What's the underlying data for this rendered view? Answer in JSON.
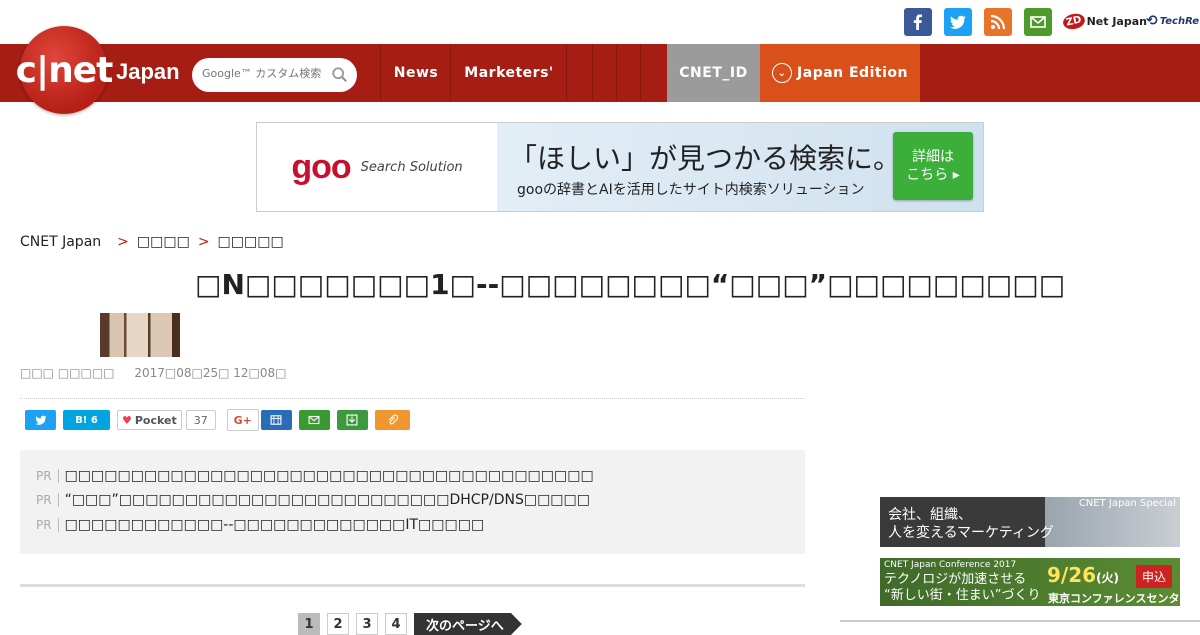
{
  "social": {
    "colors": {
      "facebook": "#3b5998",
      "twitter": "#1da1f2",
      "rss": "#e8742a",
      "mail": "#4e9a2b"
    },
    "zdnet": "Net Japan",
    "zdnet_badge": "ZD",
    "techrepublic": "TechRe"
  },
  "header": {
    "logo": "c|net",
    "logo_sub": "Japan",
    "search_placeholder": "Google™ カスタム検索",
    "nav": [
      "News",
      "Marketers'"
    ],
    "cnet_id": "CNET_ID",
    "edition": "Japan Edition",
    "colors": {
      "bar": "#a61d14",
      "cnet_id_bg": "#9b9b9b",
      "edition_bg": "#d9501a"
    }
  },
  "ad": {
    "brand": "goo",
    "brand_sub": "Search Solution",
    "headline": "「ほしい」が見つかる検索に。",
    "sub": "gooの辞書とAIを活用したサイト内検索ソリューション",
    "button_line1": "詳細は",
    "button_line2": "こちら ▸"
  },
  "breadcrumb": {
    "home": "CNET Japan",
    "sep": ">",
    "level1": "□□□□",
    "level2": "□□□□□"
  },
  "article": {
    "title": "□N□□□□□□□1□--□□□□□□□□“□□□”□□□□□□□□□",
    "author": "□□□ □□□□□",
    "date": "2017□08□25□ 12□08□"
  },
  "share": {
    "hatena": "B! 6",
    "pocket": "Pocket",
    "pocket_count": "37",
    "gplus": "G+"
  },
  "pr": [
    {
      "tag": "PR",
      "text": "□□□□□□□□□□□□□□□□□□□□□□□□□□□□□□□□□□□□□□□□"
    },
    {
      "tag": "PR",
      "text": "“□□□”□□□□□□□□□□□□□□□□□□□□□□□□□DHCP/DNS□□□□□"
    },
    {
      "tag": "PR",
      "text": "□□□□□□□□□□□□--□□□□□□□□□□□□□IT□□□□□"
    }
  ],
  "pagination": {
    "pages": [
      "1",
      "2",
      "3",
      "4"
    ],
    "next": "次のページへ"
  },
  "promos": {
    "p1_label": "CNET Japan Special",
    "p1_line1": "会社、組織、",
    "p1_line2": "人を変えるマーケティング",
    "p2_label": "CNET Japan Conference 2017",
    "p2_line1": "テクノロジが加速させる",
    "p2_line2": "“新しい街・住まい”づくり",
    "p2_date": "9/26",
    "p2_day": "(火)",
    "p2_venue": "東京コンファレンスセンター",
    "p2_apply": "申込"
  }
}
